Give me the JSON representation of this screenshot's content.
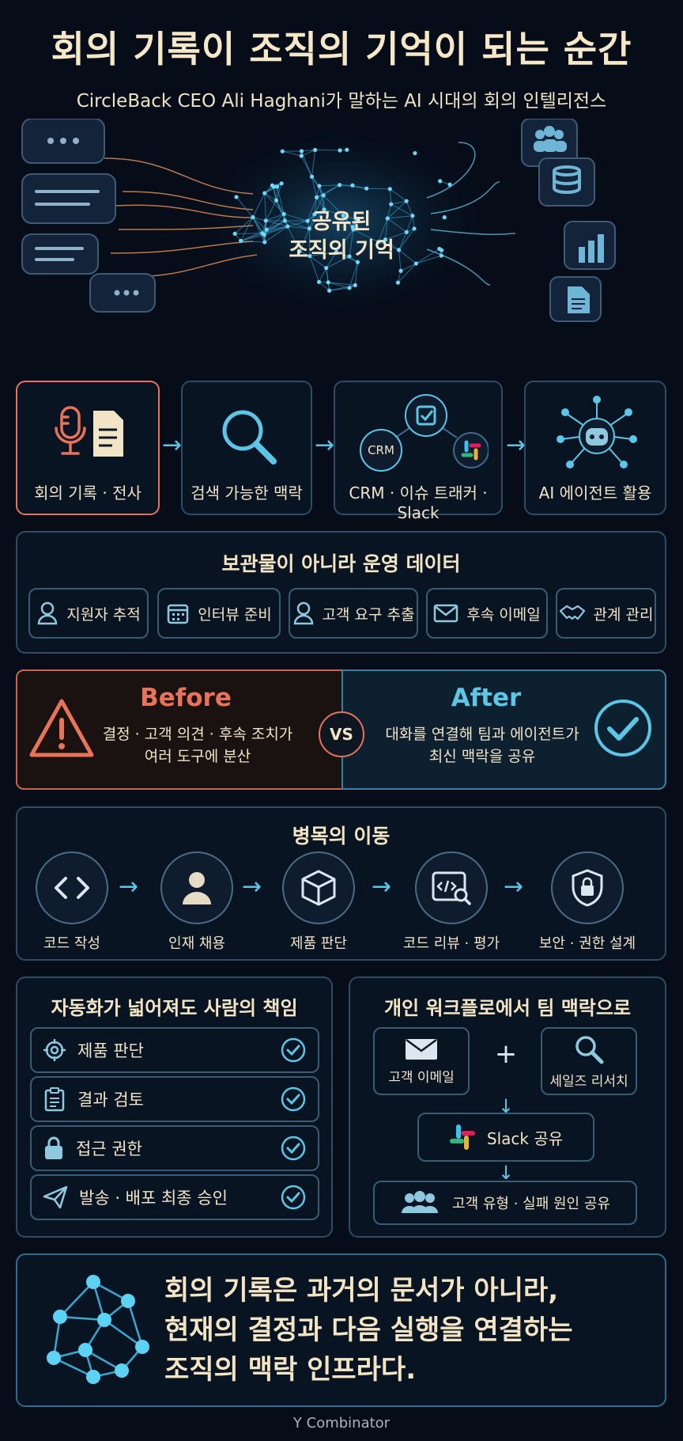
{
  "header": {
    "title": "회의 기록이 조직의 기억이 되는 순간",
    "subtitle": "CircleBack CEO Ali Haghani가 말하는 AI 시대의 회의 인텔리전스"
  },
  "hero": {
    "center_line1": "공유된",
    "center_line2": "조직의 기억"
  },
  "flow": {
    "steps": [
      {
        "label": "회의 기록 · 전사",
        "icon": "microphone-document-icon"
      },
      {
        "label": "검색 가능한 맥락",
        "icon": "search-icon"
      },
      {
        "label": "CRM · 이슈 트래커 · Slack",
        "icon": "integration-icon",
        "crm_text": "CRM"
      },
      {
        "label": "AI 에이전트 활용",
        "icon": "robot-network-icon"
      }
    ]
  },
  "ops": {
    "title": "보관물이 아니라 운영 데이터",
    "items": [
      {
        "label": "지원자 추적",
        "icon": "person-icon"
      },
      {
        "label": "인터뷰 준비",
        "icon": "calendar-icon"
      },
      {
        "label": "고객 요구 추출",
        "icon": "person-icon"
      },
      {
        "label": "후속 이메일",
        "icon": "mail-icon"
      },
      {
        "label": "관계 관리",
        "icon": "handshake-icon"
      }
    ]
  },
  "compare": {
    "before": {
      "title": "Before",
      "line1": "결정 · 고객 의견 · 후속 조치가",
      "line2": "여러 도구에 분산"
    },
    "vs": "VS",
    "after": {
      "title": "After",
      "line1": "대화를 연결해 팀과 에이전트가",
      "line2": "최신 맥락을 공유"
    }
  },
  "bottleneck": {
    "title": "병목의 이동",
    "steps": [
      {
        "label": "코드 작성",
        "icon": "code-icon"
      },
      {
        "label": "인재 채용",
        "icon": "person-icon"
      },
      {
        "label": "제품 판단",
        "icon": "cube-icon"
      },
      {
        "label": "코드 리뷰 · 평가",
        "icon": "code-review-icon"
      },
      {
        "label": "보안 · 권한 설계",
        "icon": "shield-lock-icon"
      }
    ]
  },
  "responsibility": {
    "title": "자동화가 넓어져도 사람의 책임",
    "items": [
      {
        "label": "제품 판단",
        "icon": "target-icon"
      },
      {
        "label": "결과 검토",
        "icon": "clipboard-icon"
      },
      {
        "label": "접근 권한",
        "icon": "lock-icon"
      },
      {
        "label": "발송 · 배포 최종 승인",
        "icon": "send-icon"
      }
    ]
  },
  "workflow": {
    "title": "개인 워크플로에서 팀 맥락으로",
    "email": "고객 이메일",
    "plus": "+",
    "research": "세일즈 리서치",
    "slack": "Slack 공유",
    "team": "고객 유형 · 실패 원인 공유"
  },
  "conclusion": {
    "line1": "회의 기록은 과거의 문서가 아니라,",
    "line2": "현재의 결정과 다음 실행을 연결하는",
    "line3": "조직의 맥락 인프라다."
  },
  "footer": {
    "source": "Y Combinator"
  },
  "colors": {
    "accent_blue": "#5cc6e6",
    "accent_orange": "#e8735a",
    "cream": "#f3e4c4",
    "background": "#060c18"
  }
}
